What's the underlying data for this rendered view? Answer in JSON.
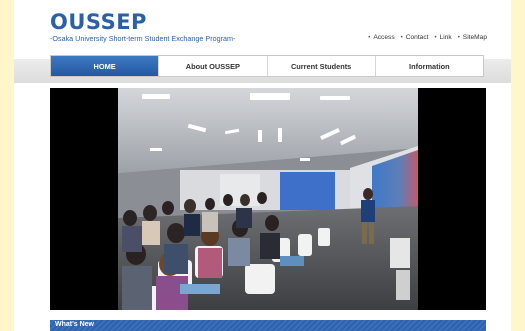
{
  "brand": {
    "title": "OUSSEP",
    "subtitle": "-Osaka University Short-term Student Exchange Program-"
  },
  "top_links": [
    "Access",
    "Contact",
    "Link",
    "SiteMap"
  ],
  "nav": {
    "items": [
      "HOME",
      "About OUSSEP",
      "Current Students",
      "Information"
    ],
    "active": "HOME"
  },
  "hero": {
    "image": "photo-lecture-hall-with-students-and-presenter"
  },
  "news": {
    "heading": "What's New"
  },
  "colors": {
    "brand_blue": "#2b5fa8",
    "nav_active": "#2e64ad",
    "outer_bg": "#fff6c9"
  }
}
